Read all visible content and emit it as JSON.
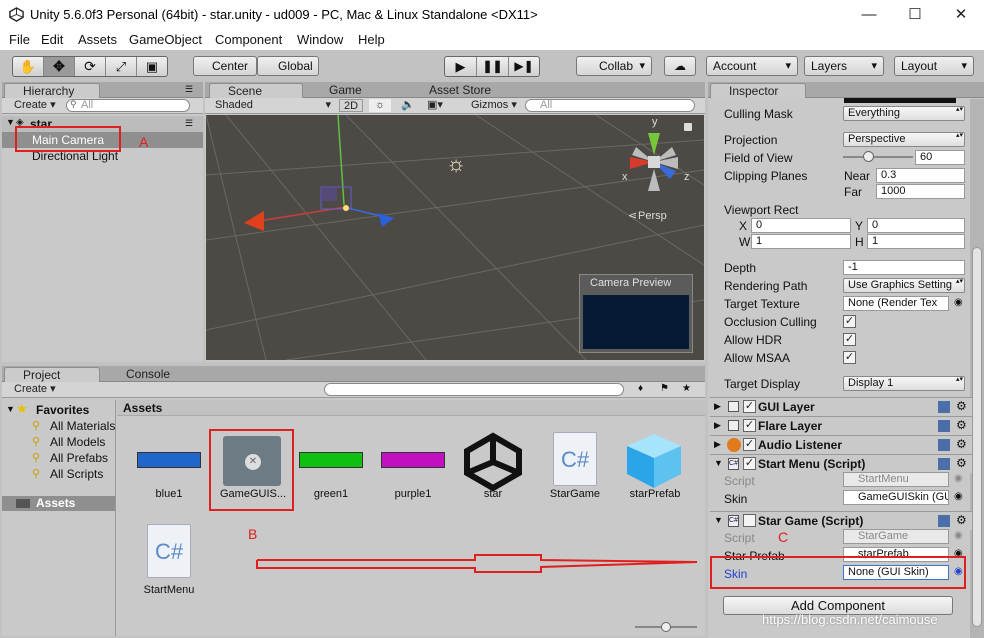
{
  "window": {
    "title": "Unity 5.6.0f3 Personal (64bit) - star.unity - ud009 - PC, Mac & Linux Standalone <DX11>",
    "minimize": "—",
    "maximize": "☐",
    "close": "✕"
  },
  "menu": [
    "File",
    "Edit",
    "Assets",
    "GameObject",
    "Component",
    "Window",
    "Help"
  ],
  "toolbar": {
    "center": "Center",
    "global": "Global",
    "collab": "Collab",
    "account": "Account",
    "layers": "Layers",
    "layout": "Layout"
  },
  "hierarchy": {
    "tab": "Hierarchy",
    "create": "Create",
    "search": "All",
    "scene": "star",
    "items": [
      "Main Camera",
      "Directional Light"
    ]
  },
  "scene": {
    "tabs": [
      "Scene",
      "Game",
      "Asset Store"
    ],
    "shaded": "Shaded",
    "mode2d": "2D",
    "gizmos": "Gizmos",
    "search": "All",
    "persp": "Persp",
    "preview_title": "Camera Preview",
    "axes": {
      "y": "y",
      "x": "x",
      "z": "z"
    }
  },
  "project": {
    "tabs": [
      "Project",
      "Console"
    ],
    "create": "Create",
    "favorites_label": "Favorites",
    "favorites": [
      "All Materials",
      "All Models",
      "All Prefabs",
      "All Scripts"
    ],
    "assets_root": "Assets",
    "breadcrumb": "Assets",
    "assets": [
      {
        "name": "blue1",
        "color": "#2266cc"
      },
      {
        "name": "GameGUIS..."
      },
      {
        "name": "green1",
        "color": "#10c010"
      },
      {
        "name": "purple1",
        "color": "#c010c0"
      },
      {
        "name": "star"
      },
      {
        "name": "StarGame"
      },
      {
        "name": "starPrefab"
      },
      {
        "name": "StartMenu"
      }
    ],
    "slider_value": 0.5
  },
  "inspector": {
    "tab": "Inspector",
    "culling_mask": {
      "label": "Culling Mask",
      "value": "Everything"
    },
    "projection": {
      "label": "Projection",
      "value": "Perspective"
    },
    "fov": {
      "label": "Field of View",
      "value": "60"
    },
    "clipping": {
      "label": "Clipping Planes",
      "near_label": "Near",
      "near": "0.3",
      "far_label": "Far",
      "far": "1000"
    },
    "viewport": {
      "label": "Viewport Rect",
      "x_label": "X",
      "x": "0",
      "y_label": "Y",
      "y": "0",
      "w_label": "W",
      "w": "1",
      "h_label": "H",
      "h": "1"
    },
    "depth": {
      "label": "Depth",
      "value": "-1"
    },
    "rendering_path": {
      "label": "Rendering Path",
      "value": "Use Graphics Setting"
    },
    "target_texture": {
      "label": "Target Texture",
      "value": "None (Render Tex"
    },
    "occlusion": {
      "label": "Occlusion Culling",
      "checked": true
    },
    "hdr": {
      "label": "Allow HDR",
      "checked": true
    },
    "msaa": {
      "label": "Allow MSAA",
      "checked": true
    },
    "target_display": {
      "label": "Target Display",
      "value": "Display 1"
    },
    "components": [
      "GUI Layer",
      "Flare Layer",
      "Audio Listener"
    ],
    "start_menu": {
      "name": "Start Menu (Script)",
      "script_label": "Script",
      "script": "StartMenu",
      "skin_label": "Skin",
      "skin": "GameGUISkin (GUI"
    },
    "star_game": {
      "name": "Star Game (Script)",
      "script_label": "Script",
      "script": "StarGame",
      "prefab_label": "Star Prefab",
      "prefab": "starPrefab",
      "skin_label": "Skin",
      "skin": "None (GUI Skin)"
    },
    "add_component": "Add Component"
  },
  "annotations": {
    "a": "A",
    "b": "B",
    "c": "C"
  },
  "watermark": "https://blog.csdn.net/caimouse",
  "colors": {
    "highlight_red": "#e02020",
    "scene_bg": "#4d4a46",
    "selection": "#3a72d8"
  }
}
